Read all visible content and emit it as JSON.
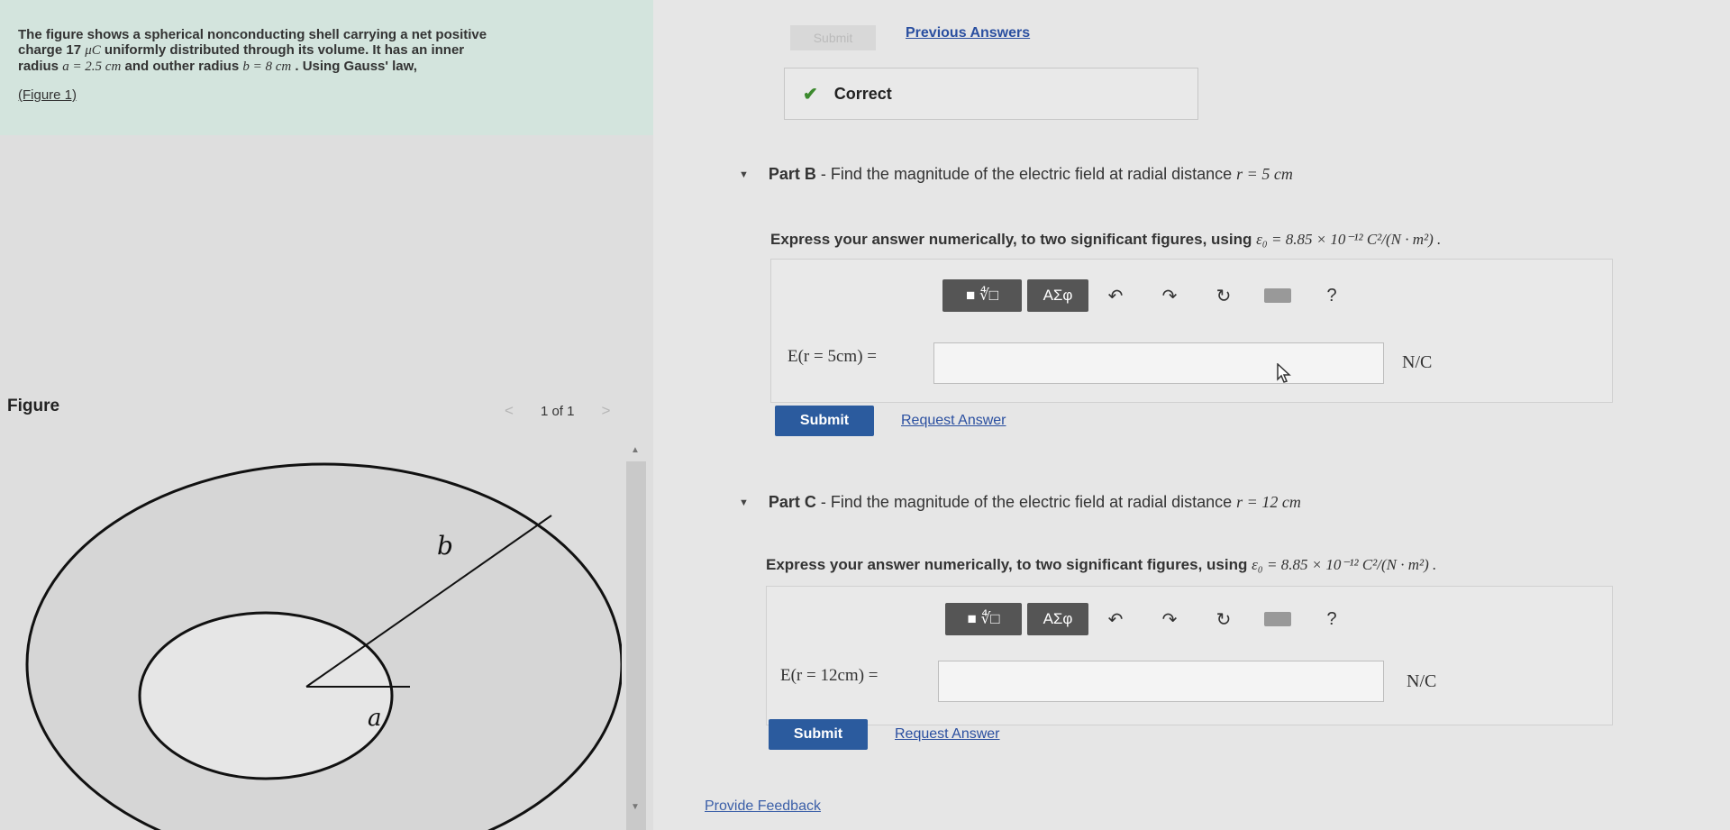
{
  "problem": {
    "line1": "The figure shows a spherical nonconducting shell carrying a net positive",
    "line2_pre": "charge 17 ",
    "line2_unit": "μC",
    "line2_post": " uniformly distributed through its volume. It has an inner",
    "line3_pre": "radius ",
    "line3_a": "a = 2.5 cm",
    "line3_mid": " and outher radius ",
    "line3_b": "b = 8 cm",
    "line3_post": " . Using Gauss' law,",
    "figure_link": "(Figure 1)"
  },
  "figure": {
    "title": "Figure",
    "pager_text": "1 of 1",
    "prev_arrow": "<",
    "next_arrow": ">",
    "label_b": "b",
    "label_a": "a"
  },
  "part_a": {
    "submit_label": "Submit",
    "previous_answers": "Previous Answers",
    "correct_label": "Correct",
    "check_icon": "✔"
  },
  "part_b": {
    "title_bold": "Part B",
    "title_rest": " - Find the magnitude of the electric field at radial distance ",
    "title_math": "r = 5 cm",
    "instruction_pre": "Express your answer numerically, to two significant figures, using ",
    "instruction_math": "ε₀ = 8.85 × 10⁻¹² C²/(N · m²) .",
    "eq_label": "E(r = 5cm) =",
    "input_value": "",
    "unit": "N/C",
    "submit_label": "Submit",
    "request_answer": "Request Answer"
  },
  "part_c": {
    "title_bold": "Part C",
    "title_rest": " - Find the magnitude of the electric field at radial distance ",
    "title_math": "r = 12 cm",
    "instruction_pre": "Express your answer numerically, to two significant figures, using ",
    "instruction_math": "ε₀ = 8.85 × 10⁻¹² C²/(N · m²) .",
    "eq_label": "E(r = 12cm) =",
    "input_value": "",
    "unit": "N/C",
    "submit_label": "Submit",
    "request_answer": "Request Answer"
  },
  "toolbar": {
    "templates_glyph": "■ ∜□",
    "greek_label": "ΑΣφ",
    "undo_glyph": "↶",
    "redo_glyph": "↷",
    "reset_glyph": "↻",
    "help_glyph": "?"
  },
  "footer": {
    "provide_feedback": "Provide Feedback"
  },
  "colors": {
    "problem_bg": "#d3e4dd",
    "link": "#2a4fa0",
    "submit": "#2b5b9e",
    "correct_check": "#3c8a2e"
  }
}
